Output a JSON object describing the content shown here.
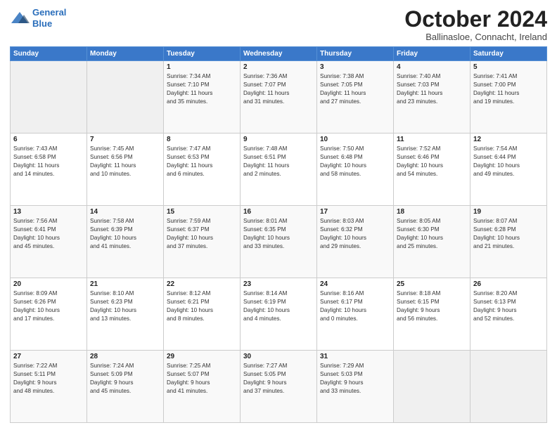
{
  "header": {
    "logo_line1": "General",
    "logo_line2": "Blue",
    "month": "October 2024",
    "location": "Ballinasloe, Connacht, Ireland"
  },
  "days_of_week": [
    "Sunday",
    "Monday",
    "Tuesday",
    "Wednesday",
    "Thursday",
    "Friday",
    "Saturday"
  ],
  "weeks": [
    [
      {
        "num": "",
        "info": ""
      },
      {
        "num": "",
        "info": ""
      },
      {
        "num": "1",
        "info": "Sunrise: 7:34 AM\nSunset: 7:10 PM\nDaylight: 11 hours\nand 35 minutes."
      },
      {
        "num": "2",
        "info": "Sunrise: 7:36 AM\nSunset: 7:07 PM\nDaylight: 11 hours\nand 31 minutes."
      },
      {
        "num": "3",
        "info": "Sunrise: 7:38 AM\nSunset: 7:05 PM\nDaylight: 11 hours\nand 27 minutes."
      },
      {
        "num": "4",
        "info": "Sunrise: 7:40 AM\nSunset: 7:03 PM\nDaylight: 11 hours\nand 23 minutes."
      },
      {
        "num": "5",
        "info": "Sunrise: 7:41 AM\nSunset: 7:00 PM\nDaylight: 11 hours\nand 19 minutes."
      }
    ],
    [
      {
        "num": "6",
        "info": "Sunrise: 7:43 AM\nSunset: 6:58 PM\nDaylight: 11 hours\nand 14 minutes."
      },
      {
        "num": "7",
        "info": "Sunrise: 7:45 AM\nSunset: 6:56 PM\nDaylight: 11 hours\nand 10 minutes."
      },
      {
        "num": "8",
        "info": "Sunrise: 7:47 AM\nSunset: 6:53 PM\nDaylight: 11 hours\nand 6 minutes."
      },
      {
        "num": "9",
        "info": "Sunrise: 7:48 AM\nSunset: 6:51 PM\nDaylight: 11 hours\nand 2 minutes."
      },
      {
        "num": "10",
        "info": "Sunrise: 7:50 AM\nSunset: 6:48 PM\nDaylight: 10 hours\nand 58 minutes."
      },
      {
        "num": "11",
        "info": "Sunrise: 7:52 AM\nSunset: 6:46 PM\nDaylight: 10 hours\nand 54 minutes."
      },
      {
        "num": "12",
        "info": "Sunrise: 7:54 AM\nSunset: 6:44 PM\nDaylight: 10 hours\nand 49 minutes."
      }
    ],
    [
      {
        "num": "13",
        "info": "Sunrise: 7:56 AM\nSunset: 6:41 PM\nDaylight: 10 hours\nand 45 minutes."
      },
      {
        "num": "14",
        "info": "Sunrise: 7:58 AM\nSunset: 6:39 PM\nDaylight: 10 hours\nand 41 minutes."
      },
      {
        "num": "15",
        "info": "Sunrise: 7:59 AM\nSunset: 6:37 PM\nDaylight: 10 hours\nand 37 minutes."
      },
      {
        "num": "16",
        "info": "Sunrise: 8:01 AM\nSunset: 6:35 PM\nDaylight: 10 hours\nand 33 minutes."
      },
      {
        "num": "17",
        "info": "Sunrise: 8:03 AM\nSunset: 6:32 PM\nDaylight: 10 hours\nand 29 minutes."
      },
      {
        "num": "18",
        "info": "Sunrise: 8:05 AM\nSunset: 6:30 PM\nDaylight: 10 hours\nand 25 minutes."
      },
      {
        "num": "19",
        "info": "Sunrise: 8:07 AM\nSunset: 6:28 PM\nDaylight: 10 hours\nand 21 minutes."
      }
    ],
    [
      {
        "num": "20",
        "info": "Sunrise: 8:09 AM\nSunset: 6:26 PM\nDaylight: 10 hours\nand 17 minutes."
      },
      {
        "num": "21",
        "info": "Sunrise: 8:10 AM\nSunset: 6:23 PM\nDaylight: 10 hours\nand 13 minutes."
      },
      {
        "num": "22",
        "info": "Sunrise: 8:12 AM\nSunset: 6:21 PM\nDaylight: 10 hours\nand 8 minutes."
      },
      {
        "num": "23",
        "info": "Sunrise: 8:14 AM\nSunset: 6:19 PM\nDaylight: 10 hours\nand 4 minutes."
      },
      {
        "num": "24",
        "info": "Sunrise: 8:16 AM\nSunset: 6:17 PM\nDaylight: 10 hours\nand 0 minutes."
      },
      {
        "num": "25",
        "info": "Sunrise: 8:18 AM\nSunset: 6:15 PM\nDaylight: 9 hours\nand 56 minutes."
      },
      {
        "num": "26",
        "info": "Sunrise: 8:20 AM\nSunset: 6:13 PM\nDaylight: 9 hours\nand 52 minutes."
      }
    ],
    [
      {
        "num": "27",
        "info": "Sunrise: 7:22 AM\nSunset: 5:11 PM\nDaylight: 9 hours\nand 48 minutes."
      },
      {
        "num": "28",
        "info": "Sunrise: 7:24 AM\nSunset: 5:09 PM\nDaylight: 9 hours\nand 45 minutes."
      },
      {
        "num": "29",
        "info": "Sunrise: 7:25 AM\nSunset: 5:07 PM\nDaylight: 9 hours\nand 41 minutes."
      },
      {
        "num": "30",
        "info": "Sunrise: 7:27 AM\nSunset: 5:05 PM\nDaylight: 9 hours\nand 37 minutes."
      },
      {
        "num": "31",
        "info": "Sunrise: 7:29 AM\nSunset: 5:03 PM\nDaylight: 9 hours\nand 33 minutes."
      },
      {
        "num": "",
        "info": ""
      },
      {
        "num": "",
        "info": ""
      }
    ]
  ]
}
